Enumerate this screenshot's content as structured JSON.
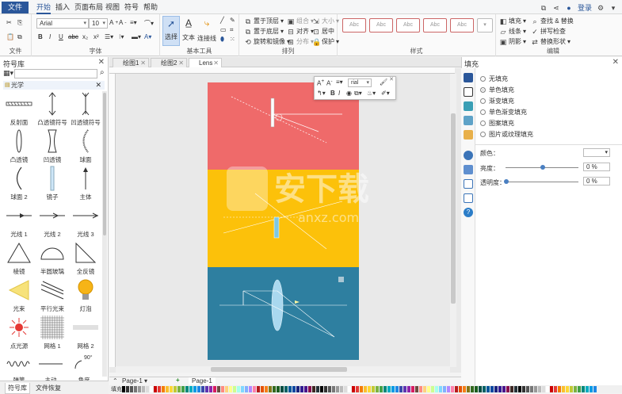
{
  "menubar": {
    "file": "文件",
    "items": [
      "开始",
      "插入",
      "页面布局",
      "视图",
      "符号",
      "帮助"
    ],
    "login": "登录"
  },
  "ribbon": {
    "file_group": "文件",
    "font_group": "字体",
    "font_name": "Arial",
    "font_size": "10",
    "basic_tools_group": "基本工具",
    "select": "选择",
    "text": "文本",
    "connector": "连接线",
    "arrange_group": "排列",
    "arrange": [
      "置于顶层",
      "置于底层",
      "旋转和镜像",
      "组合",
      "对齐",
      "分布",
      "大小",
      "居中",
      "保护"
    ],
    "style_group": "样式",
    "style_swatch_text": "Abc",
    "fill": "填充",
    "line": "线条",
    "shadow": "阴影",
    "edit_group": "编辑",
    "find_replace": "查找 & 替换",
    "spell_check": "拼写检查",
    "replace_shape": "替换形状"
  },
  "library": {
    "title": "符号库",
    "section": "光学",
    "symbols": [
      {
        "label": "反射面",
        "icon": "reflector-icon"
      },
      {
        "label": "凸透镜符号",
        "icon": "convex-lens-symbol-icon"
      },
      {
        "label": "凹透镜符号",
        "icon": "concave-lens-symbol-icon"
      },
      {
        "label": "凸透镜",
        "icon": "convex-lens-icon"
      },
      {
        "label": "凹透镜",
        "icon": "concave-lens-icon"
      },
      {
        "label": "球面",
        "icon": "spherical-surface-icon"
      },
      {
        "label": "球面 2",
        "icon": "spherical-surface-2-icon"
      },
      {
        "label": "镜子",
        "icon": "mirror-icon"
      },
      {
        "label": "主体",
        "icon": "object-arrow-icon"
      },
      {
        "label": "光线 1",
        "icon": "ray-1-icon"
      },
      {
        "label": "光线 2",
        "icon": "ray-2-icon"
      },
      {
        "label": "光线 3",
        "icon": "ray-3-icon"
      },
      {
        "label": "棱镜",
        "icon": "prism-icon"
      },
      {
        "label": "半圆玻璃",
        "icon": "semicircle-glass-icon"
      },
      {
        "label": "全反镜",
        "icon": "total-reflector-icon"
      },
      {
        "label": "光束",
        "icon": "light-beam-icon"
      },
      {
        "label": "平行光束",
        "icon": "parallel-beam-icon"
      },
      {
        "label": "灯泡",
        "icon": "bulb-icon"
      },
      {
        "label": "点光源",
        "icon": "point-source-icon"
      },
      {
        "label": "网格 1",
        "icon": "grid-1-icon"
      },
      {
        "label": "网格 2",
        "icon": "grid-2-icon"
      }
    ],
    "partial_labels": [
      "弹簧",
      "主动",
      "角度"
    ],
    "angle_text": "90°",
    "bottom_tabs": [
      "符号库",
      "文件恢复"
    ]
  },
  "tabs": [
    {
      "label": "绘图1"
    },
    {
      "label": "绘图2"
    },
    {
      "label": "Lens"
    }
  ],
  "canvas": {
    "colors": {
      "top": "#ef6a6a",
      "middle": "#fcc10a",
      "bottom": "#2e7fa0"
    },
    "float_toolbar_font": "rial"
  },
  "watermark": {
    "main": "安下载",
    "sub": "anxz.com"
  },
  "pagebar": {
    "page_tab": "Page-1",
    "current_page": "Page-1",
    "fill_label": "填充"
  },
  "fill_panel": {
    "title": "填充",
    "options": [
      "无填充",
      "单色填充",
      "渐变填充",
      "单色渐变填充",
      "图案填充",
      "图片或纹理填充"
    ],
    "selected_index": 1,
    "color_label": "颜色：",
    "brightness_label": "亮度：",
    "brightness_value": "0 %",
    "transparency_label": "透明度：",
    "transparency_value": "0 %"
  }
}
